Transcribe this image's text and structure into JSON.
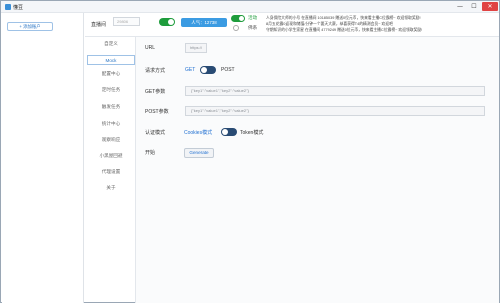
{
  "window": {
    "title": "懂豆",
    "controls": {
      "minimize": "—",
      "maximize": "☐",
      "close": "✕"
    }
  },
  "left_panel": {
    "add_account": "+ 添加账户"
  },
  "topbar": {
    "live_label": "直播间",
    "room_value": "29806",
    "popularity": "人气：12738",
    "radio_active": "活动",
    "radio_other": "佛系",
    "ticker_lines": [
      "人身保险大师的小号 在直播间 10185039 赠送0位元币，快来看主播C位霸榜~ 欢迎领取奖励!",
      "8月五花霸0返现和储值/分钟一个要天大赛，恭喜获得T4的精测会员~ 欢迎吧",
      "守期知识的小学生家星 在直播间 4779249 赠送0位元币，快来看主播C位霸榜~ 欢迎领取奖励!"
    ]
  },
  "nav": {
    "items": [
      "自定义",
      "Mock",
      "配置中心",
      "定时任务",
      "触发任务",
      "统计中心",
      "观察响应",
      "小黑屋回避",
      "代理设置",
      "关于"
    ],
    "active_index": 1
  },
  "form": {
    "url_label": "URL",
    "url_value": "https://",
    "method_label": "请求方式",
    "method_get": "GET",
    "method_post": "POST",
    "get_params_label": "GET参数",
    "get_params_value": "{\"key1\":\"value1\",\"key2\":\"value2\"}",
    "post_params_label": "POST参数",
    "post_params_value": "{\"key1\":\"value1\",\"key2\":\"value2\"}",
    "auth_label": "认证模式",
    "auth_cookie": "Cookies模式",
    "auth_token": "Token模式",
    "start_label": "开始",
    "generate_button": "Generate"
  },
  "colors": {
    "accent": "#1f6fd1",
    "toggle_green": "#1e9c3c",
    "badge_blue": "#3b9be2",
    "close_red": "#e04343"
  }
}
